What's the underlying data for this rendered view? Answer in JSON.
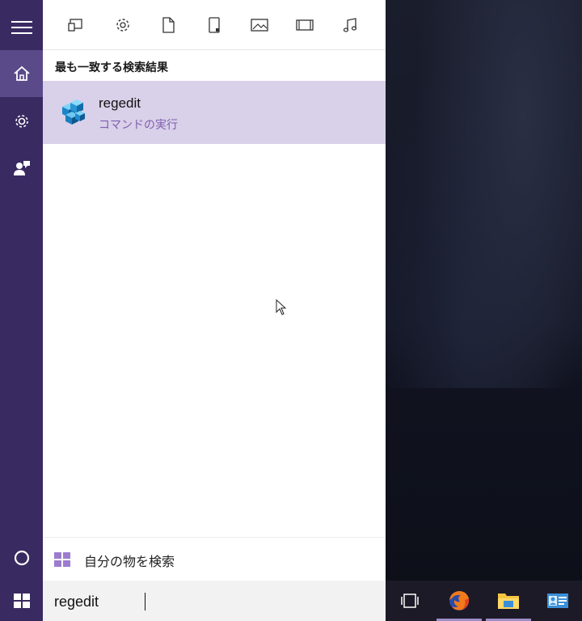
{
  "filters": [
    {
      "icon": "apps-icon"
    },
    {
      "icon": "settings-icon"
    },
    {
      "icon": "document-icon"
    },
    {
      "icon": "folder-icon"
    },
    {
      "icon": "photos-icon"
    },
    {
      "icon": "videos-icon"
    },
    {
      "icon": "music-icon"
    }
  ],
  "section_title": "最も一致する検索結果",
  "best_match": {
    "title": "regedit",
    "subtitle": "コマンドの実行",
    "icon": "registry-editor-icon"
  },
  "my_stuff_label": "自分の物を検索",
  "search": {
    "value": "regedit"
  },
  "rail": {
    "items": [
      "menu-icon",
      "home-icon",
      "gear-icon",
      "feedback-icon",
      "cortana-icon"
    ]
  },
  "taskbar": {
    "items": [
      "task-view-icon",
      "firefox-icon",
      "file-explorer-icon",
      "contact-card-icon"
    ]
  },
  "colors": {
    "accent": "#3a2a62",
    "highlight": "#d9d0e9",
    "subtitle": "#7e5fb0"
  }
}
